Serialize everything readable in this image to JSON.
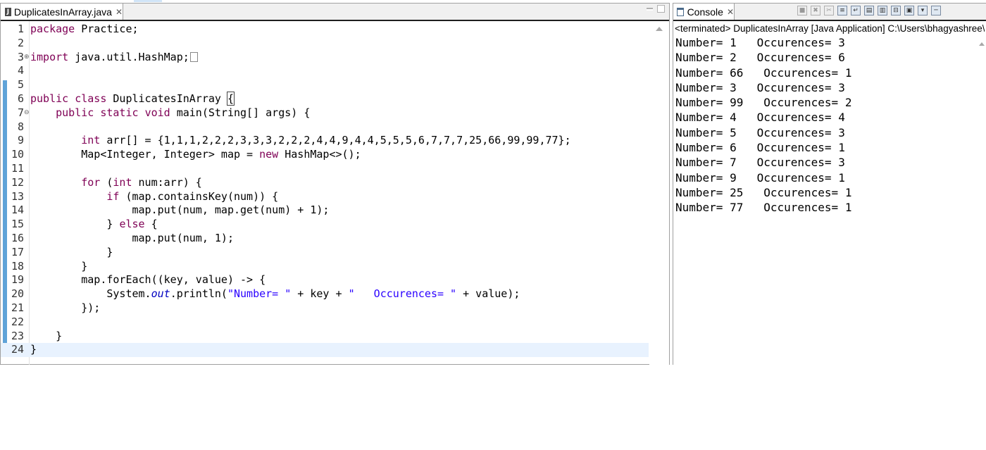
{
  "editor": {
    "tab_title": "DuplicatesInArray.java",
    "tab_icon": "java-file-icon",
    "lines": [
      {
        "n": "1",
        "parts": [
          {
            "t": "kw",
            "v": "package"
          },
          {
            "t": "ident",
            "v": " Practice;"
          }
        ]
      },
      {
        "n": "2",
        "parts": []
      },
      {
        "n": "3",
        "fold": "⊕",
        "parts": [
          {
            "t": "kw",
            "v": "import"
          },
          {
            "t": "ident",
            "v": " java.util.HashMap;"
          }
        ],
        "folded": true
      },
      {
        "n": "4",
        "parts": []
      },
      {
        "n": "5",
        "parts": []
      },
      {
        "n": "6",
        "parts": [
          {
            "t": "kw",
            "v": "public"
          },
          {
            "t": "ident",
            "v": " "
          },
          {
            "t": "kw",
            "v": "class"
          },
          {
            "t": "ident",
            "v": " DuplicatesInArray "
          },
          {
            "t": "brace",
            "v": "{"
          }
        ]
      },
      {
        "n": "7",
        "fold": "⊖",
        "parts": [
          {
            "t": "ident",
            "v": "    "
          },
          {
            "t": "kw",
            "v": "public"
          },
          {
            "t": "ident",
            "v": " "
          },
          {
            "t": "kw",
            "v": "static"
          },
          {
            "t": "ident",
            "v": " "
          },
          {
            "t": "kw",
            "v": "void"
          },
          {
            "t": "ident",
            "v": " main(String[] args) {"
          }
        ]
      },
      {
        "n": "8",
        "parts": []
      },
      {
        "n": "9",
        "parts": [
          {
            "t": "ident",
            "v": "        "
          },
          {
            "t": "kw",
            "v": "int"
          },
          {
            "t": "ident",
            "v": " arr[] = {1,1,1,2,2,2,3,3,3,2,2,2,4,4,9,4,4,5,5,5,6,7,7,7,25,66,99,99,77};"
          }
        ]
      },
      {
        "n": "10",
        "parts": [
          {
            "t": "ident",
            "v": "        Map<Integer, Integer> map = "
          },
          {
            "t": "kw",
            "v": "new"
          },
          {
            "t": "ident",
            "v": " HashMap<>();"
          }
        ]
      },
      {
        "n": "11",
        "parts": []
      },
      {
        "n": "12",
        "parts": [
          {
            "t": "ident",
            "v": "        "
          },
          {
            "t": "kw",
            "v": "for"
          },
          {
            "t": "ident",
            "v": " ("
          },
          {
            "t": "kw",
            "v": "int"
          },
          {
            "t": "ident",
            "v": " num:arr) {"
          }
        ]
      },
      {
        "n": "13",
        "parts": [
          {
            "t": "ident",
            "v": "            "
          },
          {
            "t": "kw",
            "v": "if"
          },
          {
            "t": "ident",
            "v": " (map.containsKey(num)) {"
          }
        ]
      },
      {
        "n": "14",
        "parts": [
          {
            "t": "ident",
            "v": "                map.put(num, map.get(num) + 1);"
          }
        ]
      },
      {
        "n": "15",
        "parts": [
          {
            "t": "ident",
            "v": "            } "
          },
          {
            "t": "kw",
            "v": "else"
          },
          {
            "t": "ident",
            "v": " {"
          }
        ]
      },
      {
        "n": "16",
        "parts": [
          {
            "t": "ident",
            "v": "                map.put(num, 1);"
          }
        ]
      },
      {
        "n": "17",
        "parts": [
          {
            "t": "ident",
            "v": "            }"
          }
        ]
      },
      {
        "n": "18",
        "parts": [
          {
            "t": "ident",
            "v": "        }"
          }
        ]
      },
      {
        "n": "19",
        "parts": [
          {
            "t": "ident",
            "v": "        map.forEach((key, value) -> {"
          }
        ]
      },
      {
        "n": "20",
        "parts": [
          {
            "t": "ident",
            "v": "            System."
          },
          {
            "t": "field",
            "v": "out"
          },
          {
            "t": "ident",
            "v": ".println("
          },
          {
            "t": "str",
            "v": "\"Number= \""
          },
          {
            "t": "ident",
            "v": " + key + "
          },
          {
            "t": "str",
            "v": "\"   Occurences= \""
          },
          {
            "t": "ident",
            "v": " + value);"
          }
        ]
      },
      {
        "n": "21",
        "parts": [
          {
            "t": "ident",
            "v": "        });"
          }
        ]
      },
      {
        "n": "22",
        "parts": []
      },
      {
        "n": "23",
        "parts": [
          {
            "t": "ident",
            "v": "    }"
          }
        ]
      },
      {
        "n": "24",
        "current": true,
        "parts": [
          {
            "t": "ident",
            "v": "}"
          }
        ]
      }
    ]
  },
  "console": {
    "tab_title": "Console",
    "status": "<terminated> DuplicatesInArray [Java Application] C:\\Users\\bhagyashree\\",
    "output": [
      "Number= 1   Occurences= 3",
      "Number= 2   Occurences= 6",
      "Number= 66   Occurences= 1",
      "Number= 3   Occurences= 3",
      "Number= 99   Occurences= 2",
      "Number= 4   Occurences= 4",
      "Number= 5   Occurences= 3",
      "Number= 6   Occurences= 1",
      "Number= 7   Occurences= 3",
      "Number= 9   Occurences= 1",
      "Number= 25   Occurences= 1",
      "Number= 77   Occurences= 1"
    ]
  },
  "colors": {
    "keyword": "#7f0055",
    "string": "#2a00ff",
    "field": "#0000c0",
    "current_line": "#e8f2fe",
    "change_bar": "#5fa3d8"
  }
}
